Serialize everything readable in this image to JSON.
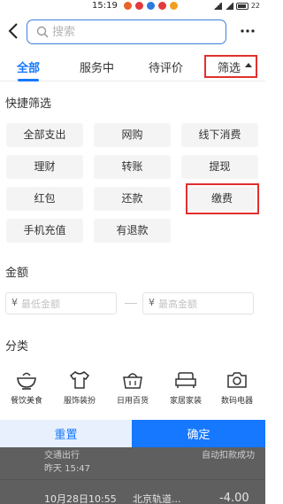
{
  "status_bar": {
    "time": "15:19",
    "battery": "22"
  },
  "header": {
    "search_placeholder": "搜索"
  },
  "tabs": [
    {
      "label": "全部",
      "active": true
    },
    {
      "label": "服务中",
      "active": false
    },
    {
      "label": "待评价",
      "active": false
    },
    {
      "label": "筛选",
      "active": false
    }
  ],
  "quick_filter": {
    "title": "快捷筛选",
    "chips": [
      "全部支出",
      "网购",
      "线下消费",
      "理财",
      "转账",
      "提现",
      "红包",
      "还款",
      "缴费",
      "手机充值",
      "有退款"
    ],
    "highlighted": "缴费"
  },
  "amount": {
    "title": "金额",
    "currency_symbol": "¥",
    "min_placeholder": "最低金额",
    "max_placeholder": "最高金额"
  },
  "category": {
    "title": "分类",
    "items": [
      {
        "label": "餐饮美食",
        "icon": "bowl-icon"
      },
      {
        "label": "服饰装扮",
        "icon": "shirt-icon"
      },
      {
        "label": "日用百货",
        "icon": "basket-icon"
      },
      {
        "label": "家居家装",
        "icon": "sofa-icon"
      },
      {
        "label": "数码电器",
        "icon": "camera-icon"
      }
    ]
  },
  "footer": {
    "reset_label": "重置",
    "confirm_label": "确定"
  },
  "background_list": {
    "merchant_prev": "交通出行",
    "date_prev": "昨天  15:47",
    "status_prev": "自动扣款成功",
    "date_next": "10月28日10:55",
    "merchant_next": "北京轨道...",
    "amount_next": "-4.00"
  },
  "colors": {
    "accent": "#1677ff",
    "highlight": "#e0302f",
    "chip_bg": "#f4f4f4"
  }
}
